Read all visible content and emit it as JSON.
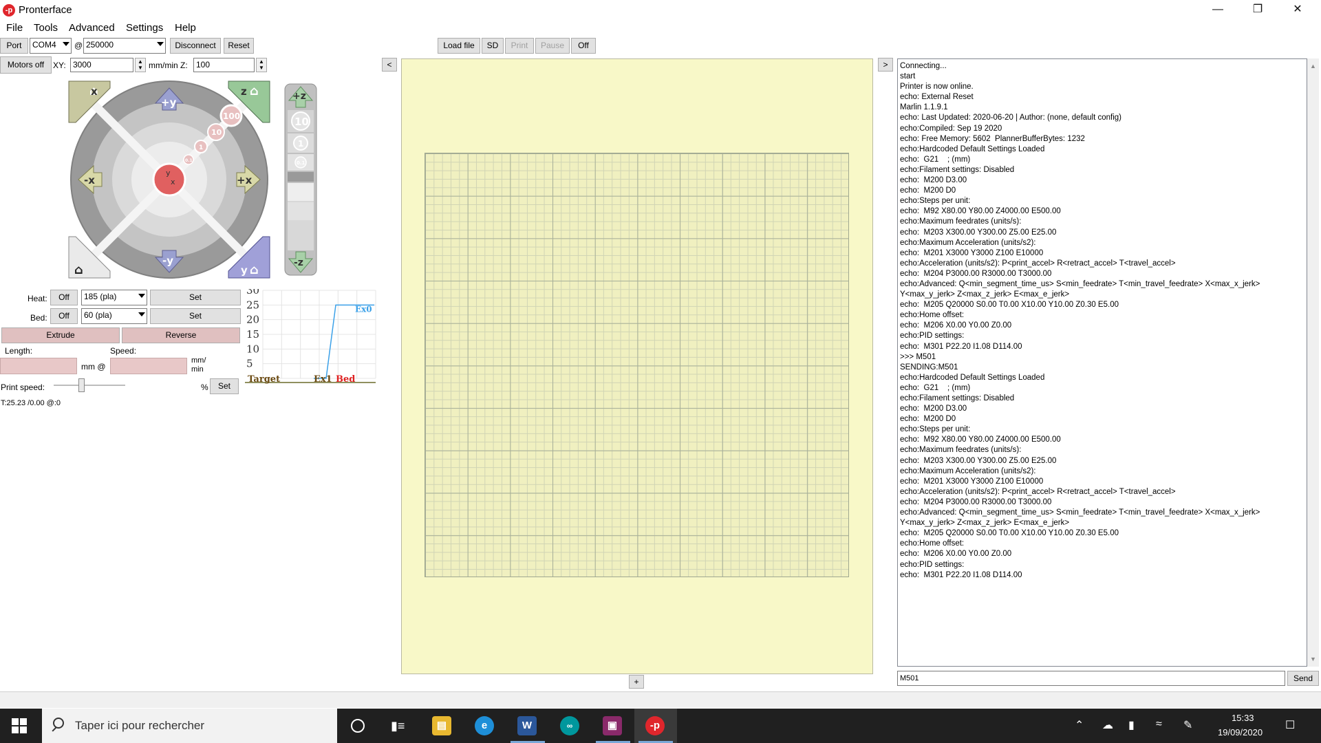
{
  "window": {
    "title": "Pronterface",
    "icon": "pronterface-logo-icon"
  },
  "menu": [
    "File",
    "Tools",
    "Advanced",
    "Settings",
    "Help"
  ],
  "toolbar": {
    "port_label": "Port",
    "port_value": "COM4",
    "at_label": "@",
    "baud_value": "250000",
    "disconnect_label": "Disconnect",
    "reset_label": "Reset",
    "motors_off_label": "Motors off",
    "xy_label": "XY:",
    "xy_value": "3000",
    "xy_unit": "mm/min Z:",
    "z_value": "100",
    "load_file_label": "Load file",
    "sd_label": "SD",
    "print_label": "Print",
    "pause_label": "Pause",
    "off_label": "Off"
  },
  "jog": {
    "home_x": "x",
    "home_z": "z",
    "home_y": "y",
    "plus_y": "+y",
    "minus_y": "-y",
    "minus_x": "-x",
    "plus_x": "+x",
    "steps": [
      "100",
      "10",
      "1",
      "0.1"
    ],
    "z_plus": "+z",
    "z_minus": "-z",
    "z_steps": [
      "10",
      "1",
      "0.1"
    ]
  },
  "temps": {
    "heat_label": "Heat:",
    "heat_off": "Off",
    "heat_value": "185 (pla)",
    "heat_set": "Set",
    "bed_label": "Bed:",
    "bed_off": "Off",
    "bed_value": "60 (pla)",
    "bed_set": "Set",
    "extrude_label": "Extrude",
    "reverse_label": "Reverse",
    "length_label": "Length:",
    "speed_label": "Speed:",
    "mm_at": "mm @",
    "mm_min": "mm/\nmin",
    "print_speed_label": "Print speed:",
    "percent": "%",
    "print_speed_set": "Set",
    "print_speed_level": 0.38,
    "status": "T:25.23 /0.00 @:0"
  },
  "chart_data": {
    "type": "line",
    "y_ticks": [
      "30",
      "25",
      "20",
      "15",
      "10",
      "5"
    ],
    "ylim": [
      0,
      30
    ],
    "legend": [
      "Target",
      "Ex1",
      "Bed"
    ],
    "series": [
      {
        "name": "Ex0",
        "values": [
          0,
          0,
          25,
          25,
          25
        ],
        "color": "#3aa0e8"
      }
    ],
    "colors": {
      "target": "#6b4a12",
      "ex1": "#6b4a12",
      "bed": "#e02020"
    }
  },
  "center": {
    "expand_left": "<",
    "add_label": "+"
  },
  "console": {
    "expand_right": ">",
    "lines": [
      "Connecting...",
      "start",
      "Printer is now online.",
      "echo: External Reset",
      "Marlin 1.1.9.1",
      "echo: Last Updated: 2020-06-20 | Author: (none, default config)",
      "echo:Compiled: Sep 19 2020",
      "echo: Free Memory: 5602  PlannerBufferBytes: 1232",
      "echo:Hardcoded Default Settings Loaded",
      "echo:  G21    ; (mm)",
      "echo:Filament settings: Disabled",
      "echo:  M200 D3.00",
      "echo:  M200 D0",
      "echo:Steps per unit:",
      "echo:  M92 X80.00 Y80.00 Z4000.00 E500.00",
      "echo:Maximum feedrates (units/s):",
      "echo:  M203 X300.00 Y300.00 Z5.00 E25.00",
      "echo:Maximum Acceleration (units/s2):",
      "echo:  M201 X3000 Y3000 Z100 E10000",
      "echo:Acceleration (units/s2): P<print_accel> R<retract_accel> T<travel_accel>",
      "echo:  M204 P3000.00 R3000.00 T3000.00",
      "echo:Advanced: Q<min_segment_time_us> S<min_feedrate> T<min_travel_feedrate> X<max_x_jerk>",
      "Y<max_y_jerk> Z<max_z_jerk> E<max_e_jerk>",
      "echo:  M205 Q20000 S0.00 T0.00 X10.00 Y10.00 Z0.30 E5.00",
      "echo:Home offset:",
      "echo:  M206 X0.00 Y0.00 Z0.00",
      "echo:PID settings:",
      "echo:  M301 P22.20 I1.08 D114.00",
      ">>> M501",
      "SENDING:M501",
      "echo:Hardcoded Default Settings Loaded",
      "echo:  G21    ; (mm)",
      "echo:Filament settings: Disabled",
      "echo:  M200 D3.00",
      "echo:  M200 D0",
      "echo:Steps per unit:",
      "echo:  M92 X80.00 Y80.00 Z4000.00 E500.00",
      "echo:Maximum feedrates (units/s):",
      "echo:  M203 X300.00 Y300.00 Z5.00 E25.00",
      "echo:Maximum Acceleration (units/s2):",
      "echo:  M201 X3000 Y3000 Z100 E10000",
      "echo:Acceleration (units/s2): P<print_accel> R<retract_accel> T<travel_accel>",
      "echo:  M204 P3000.00 R3000.00 T3000.00",
      "echo:Advanced: Q<min_segment_time_us> S<min_feedrate> T<min_travel_feedrate> X<max_x_jerk>",
      "Y<max_y_jerk> Z<max_z_jerk> E<max_e_jerk>",
      "echo:  M205 Q20000 S0.00 T0.00 X10.00 Y10.00 Z0.30 E5.00",
      "echo:Home offset:",
      "echo:  M206 X0.00 Y0.00 Z0.00",
      "echo:PID settings:",
      "echo:  M301 P22.20 I1.08 D114.00"
    ],
    "input_value": "M501",
    "send_label": "Send"
  },
  "taskbar": {
    "search_placeholder": "Taper ici pour rechercher",
    "time": "15:33",
    "date": "19/09/2020",
    "apps": [
      "file-explorer-icon",
      "edge-icon",
      "word-icon",
      "arduino-icon",
      "winrar-icon",
      "pronterface-icon"
    ]
  }
}
